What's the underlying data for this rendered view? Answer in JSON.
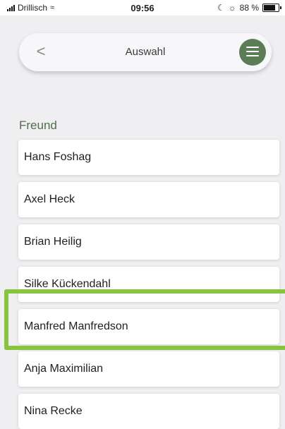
{
  "status_bar": {
    "carrier": "Drillisch",
    "time": "09:56",
    "battery": "88 %",
    "battery_level": 0.88
  },
  "header": {
    "back_glyph": "<",
    "title": "Auswahl",
    "menu_icon": "menu-icon"
  },
  "section": {
    "label": "Freund"
  },
  "contacts": [
    {
      "name": "Hans Foshag"
    },
    {
      "name": "Axel Heck"
    },
    {
      "name": "Brian Heilig"
    },
    {
      "name": "Silke Kückendahl"
    },
    {
      "name": "Manfred Manfredson"
    },
    {
      "name": "Anja Maximilian"
    },
    {
      "name": "Nina Recke"
    }
  ],
  "highlight": {
    "selected_index": 4,
    "color": "#87c540"
  },
  "colors": {
    "accent": "#5a7d55",
    "section_label": "#4f6f4c",
    "background": "#efeff1"
  }
}
